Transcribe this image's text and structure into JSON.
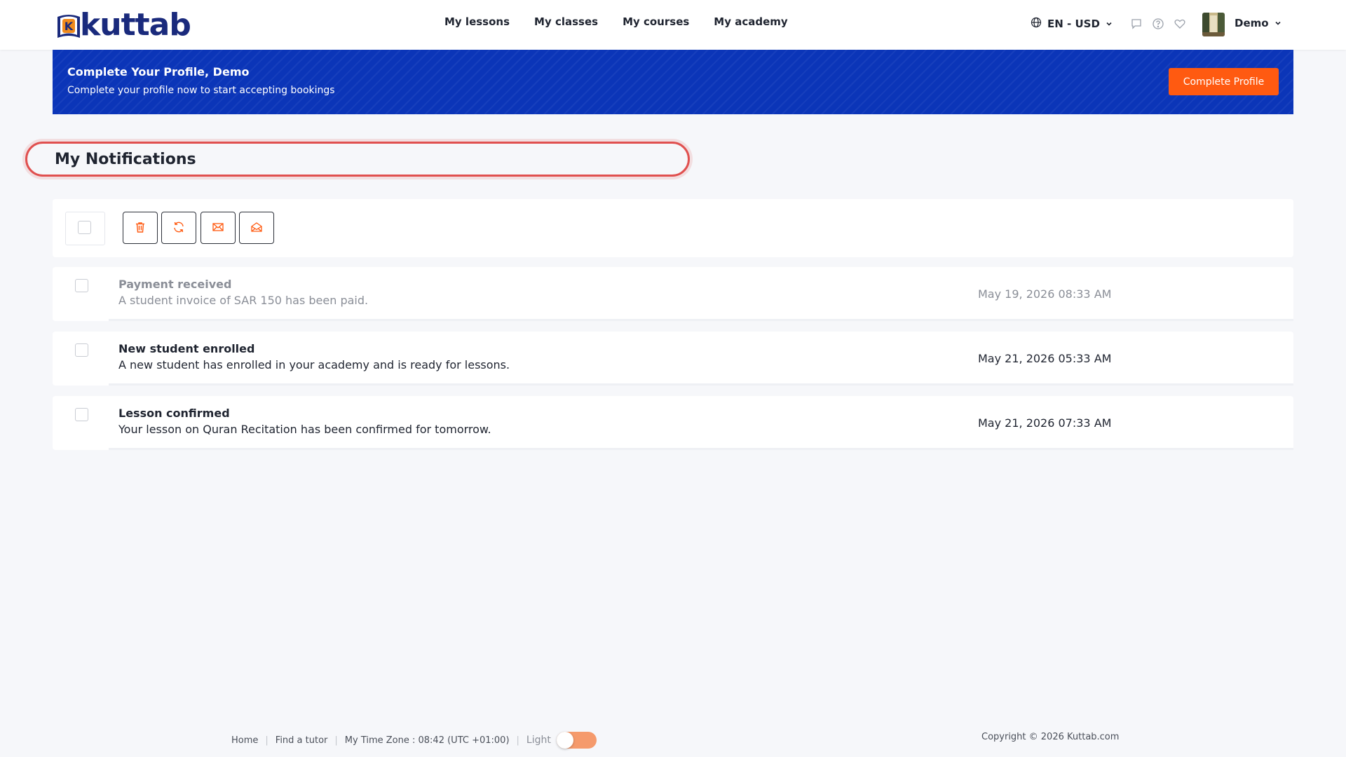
{
  "header": {
    "logo_text": "kuttab",
    "logo_letter": "K",
    "nav": [
      "My lessons",
      "My classes",
      "My courses",
      "My academy"
    ],
    "lang_label": "EN - USD",
    "icons": [
      "chat-icon",
      "help-icon",
      "heart-icon"
    ],
    "user_name": "Demo"
  },
  "banner": {
    "title": "Complete Your Profile, Demo",
    "subtitle": "Complete your profile now to start accepting bookings",
    "button_label": "Complete Profile"
  },
  "page": {
    "title": "My Notifications"
  },
  "toolbar": {
    "buttons": [
      "trash-icon",
      "refresh-icon",
      "mail-closed-icon",
      "mail-open-icon"
    ]
  },
  "notifications": [
    {
      "title": "Payment received",
      "body": "A student invoice of SAR 150 has been paid.",
      "date": "May 19, 2026 08:33 AM",
      "read": true
    },
    {
      "title": "New student enrolled",
      "body": "A new student has enrolled in your academy and is ready for lessons.",
      "date": "May 21, 2026 05:33 AM",
      "read": false
    },
    {
      "title": "Lesson confirmed",
      "body": "Your lesson on Quran Recitation has been confirmed for tomorrow.",
      "date": "May 21, 2026 07:33 AM",
      "read": false
    }
  ],
  "footer": {
    "home": "Home",
    "find_tutor": "Find a tutor",
    "timezone": "My Time Zone : 08:42 (UTC +01:00)",
    "theme_label": "Light",
    "copyright": "Copyright © 2026 Kuttab.com"
  },
  "colors": {
    "brand_navy": "#1a2a7c",
    "banner_blue": "#0b35b8",
    "accent_orange": "#ff5a11",
    "highlight_red": "#e0504f"
  }
}
